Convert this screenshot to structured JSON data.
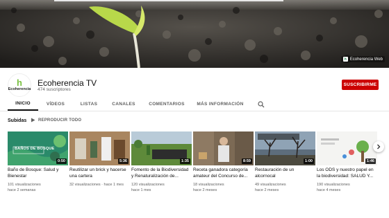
{
  "banner": {
    "link_label": "Ecoherencia Web"
  },
  "channel": {
    "avatar_text": "Ecoherencia",
    "avatar_letter": "h",
    "name": "Ecoherencia TV",
    "subscribers": "474 suscriptores",
    "subscribe_label": "SUSCRIBIRME"
  },
  "tabs": [
    {
      "label": "INICIO",
      "active": true
    },
    {
      "label": "VÍDEOS",
      "active": false
    },
    {
      "label": "LISTAS",
      "active": false
    },
    {
      "label": "CANALES",
      "active": false
    },
    {
      "label": "COMENTARIOS",
      "active": false
    },
    {
      "label": "MÁS INFORMACIÓN",
      "active": false
    }
  ],
  "section": {
    "title": "Subidas",
    "play_all": "REPRODUCIR TODO"
  },
  "videos": [
    {
      "title_line1": "Baño de Bosque: Salud y",
      "title_line2": "Bienestar",
      "views": "101 visualizaciones",
      "age": "hace 2 semanas",
      "duration": "0:50",
      "thumb_text": "BAÑOS DE BOSQUE"
    },
    {
      "title_line1": "Reutilizar un brick y hacerse",
      "title_line2": "una cartera",
      "views": "32 visualizaciones · hace 1 mes",
      "age": "",
      "duration": "5:36"
    },
    {
      "title_line1": "Fomento de la Biodiversidad",
      "title_line2": "y Renaturalización de...",
      "views": "120 visualizaciones",
      "age": "hace 1 mes",
      "duration": "1:35"
    },
    {
      "title_line1": "Receta ganadora categoría",
      "title_line2": "amateur del Concurso de...",
      "views": "18 visualizaciones",
      "age": "hace 2 meses",
      "duration": "8:59"
    },
    {
      "title_line1": "Restauración de un",
      "title_line2": "alcornocal",
      "views": "49 visualizaciones",
      "age": "hace 2 meses",
      "duration": "1:00"
    },
    {
      "title_line1": "Los ODS y nuestro papel en",
      "title_line2": "la biodiversidad: SALUD Y...",
      "views": "190 visualizaciones",
      "age": "hace 4 meses",
      "duration": "1:46"
    }
  ],
  "colors": {
    "subscribe": "#cc0000",
    "text_primary": "#0f0f0f",
    "text_secondary": "#606060"
  }
}
